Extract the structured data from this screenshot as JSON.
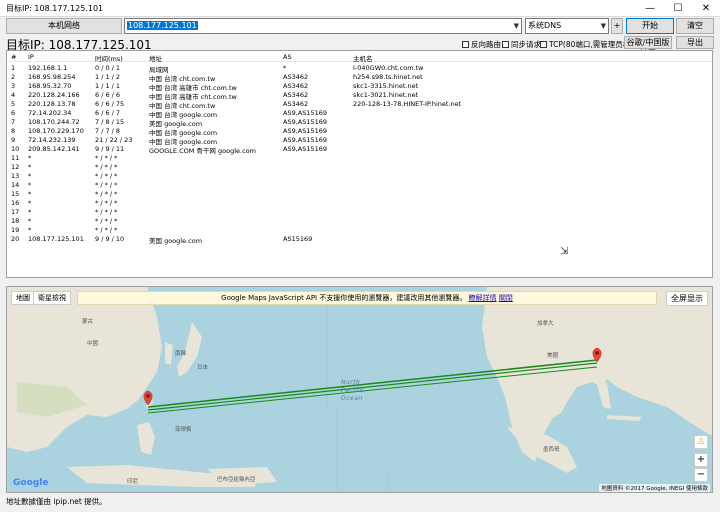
{
  "window": {
    "title": "目标IP: 108.177.125.101",
    "min": "—",
    "max": "☐",
    "close": "✕"
  },
  "toolbar": {
    "local_network": "本机网络",
    "ip_value": "108.177.125.101",
    "dns": "系统DNS",
    "plus": "+",
    "start": "开始",
    "clear": "清空"
  },
  "target": {
    "title": "目标IP: 108.177.125.101",
    "options": [
      "反向路由",
      "同步请求",
      "TCP(80端口,需管理员权限)"
    ],
    "google_map_button": "谷歌/中国版地图",
    "export_button": "导出"
  },
  "table": {
    "headers": [
      "#",
      "IP",
      "时间(ms)",
      "地址",
      "AS",
      "主机名"
    ],
    "rows": [
      [
        "1",
        "192.168.1.1",
        "0 / 0 / 1",
        "局域网",
        "*",
        "I-040GW0.cht.com.tw"
      ],
      [
        "2",
        "168.95.98.254",
        "1 / 1 / 2",
        "中国 台湾 cht.com.tw",
        "AS3462",
        "h254.s98.ts.hinet.net"
      ],
      [
        "3",
        "168.95.32.70",
        "1 / 1 / 1",
        "中国 台湾 高雄市 cht.com.tw",
        "AS3462",
        "skc1-3315.hinet.net"
      ],
      [
        "4",
        "220.128.24.166",
        "6 / 6 / 6",
        "中国 台湾 高雄市 cht.com.tw",
        "AS3462",
        "skc1-3021.hinet.net"
      ],
      [
        "5",
        "220.128.13.78",
        "6 / 6 / 75",
        "中国 台湾 cht.com.tw",
        "AS3462",
        "220-128-13-78.HINET-IP.hinet.net"
      ],
      [
        "6",
        "72.14.202.34",
        "6 / 6 / 7",
        "中国 台湾 google.com",
        "AS9,AS15169",
        ""
      ],
      [
        "7",
        "108.170.244.72",
        "7 / 8 / 15",
        "美国 google.com",
        "AS9,AS15169",
        ""
      ],
      [
        "8",
        "108.170.229.170",
        "7 / 7 / 8",
        "中国 台湾 google.com",
        "AS9,AS15169",
        ""
      ],
      [
        "9",
        "72.14.232.139",
        "21 / 22 / 23",
        "中国 台湾 google.com",
        "AS9,AS15169",
        ""
      ],
      [
        "10",
        "209.85.142.141",
        "9 / 9 / 11",
        "GOOGLE.COM 骨干网 google.com",
        "AS9,AS15169",
        ""
      ],
      [
        "11",
        "*",
        "* / * / *",
        "",
        "",
        ""
      ],
      [
        "12",
        "*",
        "* / * / *",
        "",
        "",
        ""
      ],
      [
        "13",
        "*",
        "* / * / *",
        "",
        "",
        ""
      ],
      [
        "14",
        "*",
        "* / * / *",
        "",
        "",
        ""
      ],
      [
        "15",
        "*",
        "* / * / *",
        "",
        "",
        ""
      ],
      [
        "16",
        "*",
        "* / * / *",
        "",
        "",
        ""
      ],
      [
        "17",
        "*",
        "* / * / *",
        "",
        "",
        ""
      ],
      [
        "18",
        "*",
        "* / * / *",
        "",
        "",
        ""
      ],
      [
        "19",
        "*",
        "* / * / *",
        "",
        "",
        ""
      ],
      [
        "20",
        "108.177.125.101",
        "9 / 9 / 10",
        "美国 google.com",
        "AS15169",
        ""
      ]
    ]
  },
  "map": {
    "tab_map": "地圖",
    "tab_satellite": "衛星檢視",
    "banner_text": "Google Maps JavaScript API 不支援你使用的瀏覽器，建議改用其他瀏覽器。",
    "banner_link1": "瞭解詳情",
    "banner_link2": "關閉",
    "fullscreen": "全屏显示",
    "zoom_in": "+",
    "zoom_out": "−",
    "logo": "Google",
    "attribution": "地圖資料 ©2017 Google, INEGI   使用條款",
    "labels": {
      "usa": "美國",
      "japan": "日本",
      "china": "中國",
      "mongolia": "蒙古",
      "korea": "南韓",
      "philippines": "菲律賓",
      "indonesia": "印尼",
      "papua": "巴布亞紐幾內亞",
      "mexico": "墨西哥",
      "canada": "加拿大",
      "ocean_north": "North",
      "ocean_pacific": "Pacific",
      "ocean_ocean": "Ocean"
    },
    "colors": {
      "route": "#1a8a1a",
      "marker": "#ea4335",
      "land": "#e8e4d8",
      "water": "#aad3df"
    }
  },
  "status": {
    "text": "地址數據僅由 ipip.net 提供。"
  }
}
